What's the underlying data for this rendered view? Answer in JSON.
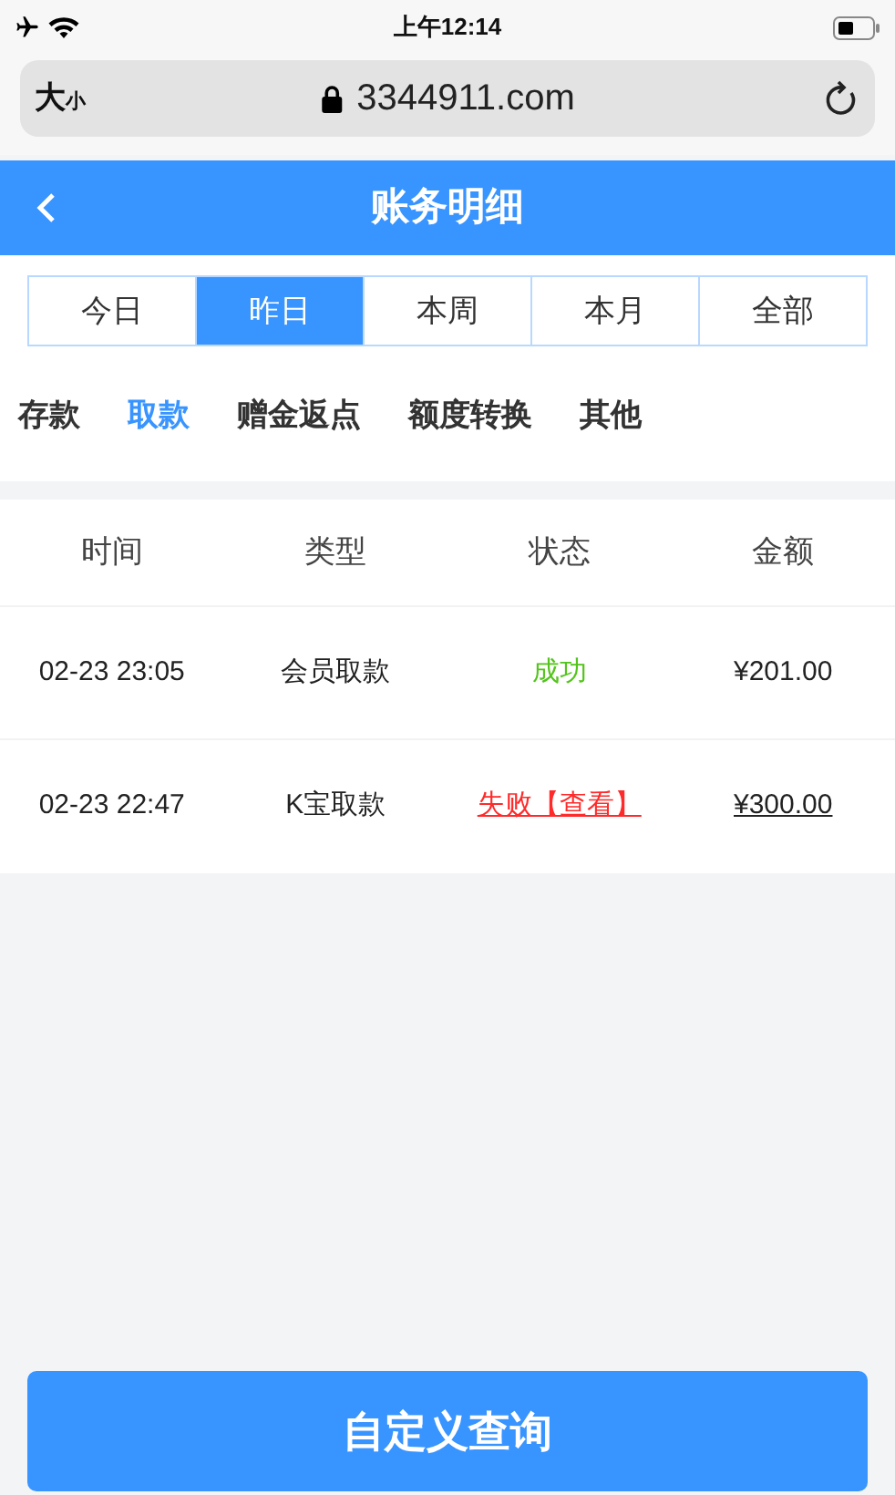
{
  "status_bar": {
    "time": "上午12:14"
  },
  "browser": {
    "text_size": "大",
    "text_size_small": "小",
    "url": "3344911.com"
  },
  "header": {
    "title": "账务明细"
  },
  "date_tabs": [
    {
      "label": "今日",
      "selected": false
    },
    {
      "label": "昨日",
      "selected": true
    },
    {
      "label": "本周",
      "selected": false
    },
    {
      "label": "本月",
      "selected": false
    },
    {
      "label": "全部",
      "selected": false
    }
  ],
  "category_tabs": [
    {
      "label": "存款",
      "selected": false
    },
    {
      "label": "取款",
      "selected": true
    },
    {
      "label": "赠金返点",
      "selected": false
    },
    {
      "label": "额度转换",
      "selected": false
    },
    {
      "label": "其他",
      "selected": false
    }
  ],
  "table": {
    "columns": [
      "时间",
      "类型",
      "状态",
      "金额"
    ],
    "rows": [
      {
        "time": "02-23 23:05",
        "type": "会员取款",
        "status": {
          "text": "成功",
          "kind": "success"
        },
        "amount": {
          "text": "¥201.00",
          "link": false
        }
      },
      {
        "time": "02-23 22:47",
        "type": "K宝取款",
        "status": {
          "text": "失败【查看】",
          "kind": "failed"
        },
        "amount": {
          "text": "¥300.00",
          "link": true
        }
      }
    ]
  },
  "query_button": "自定义查询"
}
